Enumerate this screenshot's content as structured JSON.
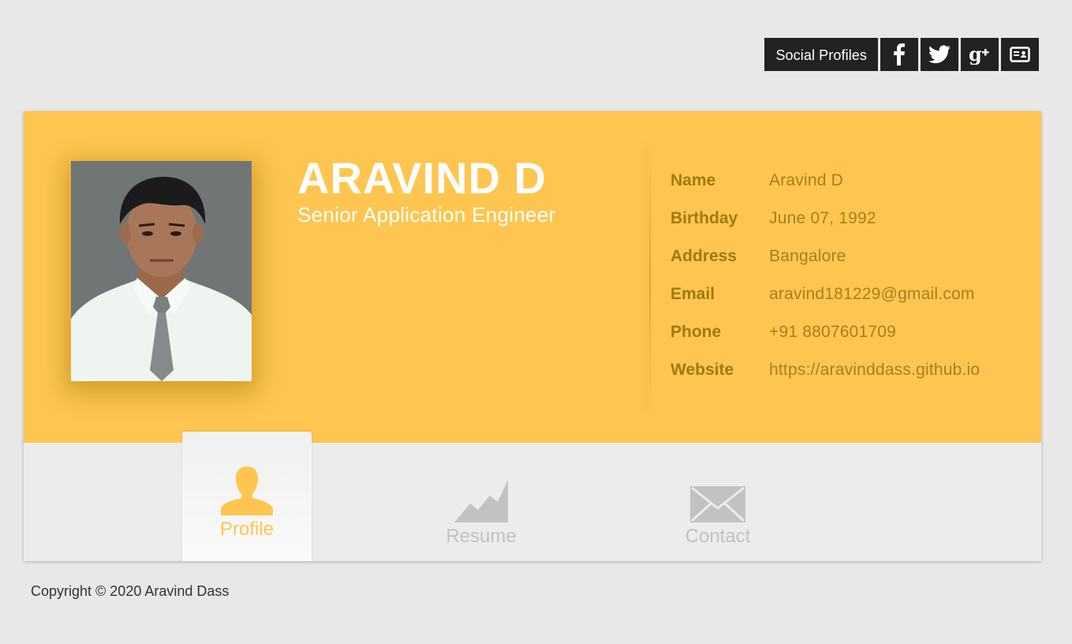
{
  "social": {
    "label": "Social Profiles",
    "buttons": [
      "facebook-icon",
      "twitter-icon",
      "google-plus-icon",
      "vcard-icon"
    ]
  },
  "profile": {
    "name": "ARAVIND D",
    "title": "Senior Application Engineer"
  },
  "info": [
    {
      "label": "Name",
      "value": "Aravind D"
    },
    {
      "label": "Birthday",
      "value": "June 07, 1992"
    },
    {
      "label": "Address",
      "value": "Bangalore"
    },
    {
      "label": "Email",
      "value": "aravind181229@gmail.com"
    },
    {
      "label": "Phone",
      "value": "+91 8807601709"
    },
    {
      "label": "Website",
      "value": "https://aravinddass.github.io"
    }
  ],
  "tabs": [
    {
      "label": "Profile",
      "icon": "user-icon",
      "active": true
    },
    {
      "label": "Resume",
      "icon": "chart-icon",
      "active": false
    },
    {
      "label": "Contact",
      "icon": "envelope-icon",
      "active": false
    }
  ],
  "footer": {
    "copyright": "Copyright © 2020 Aravind Dass"
  },
  "colors": {
    "accent": "#fec650",
    "dark": "#222222",
    "tab_inactive": "#c2c2c2",
    "label": "#a07a10"
  }
}
